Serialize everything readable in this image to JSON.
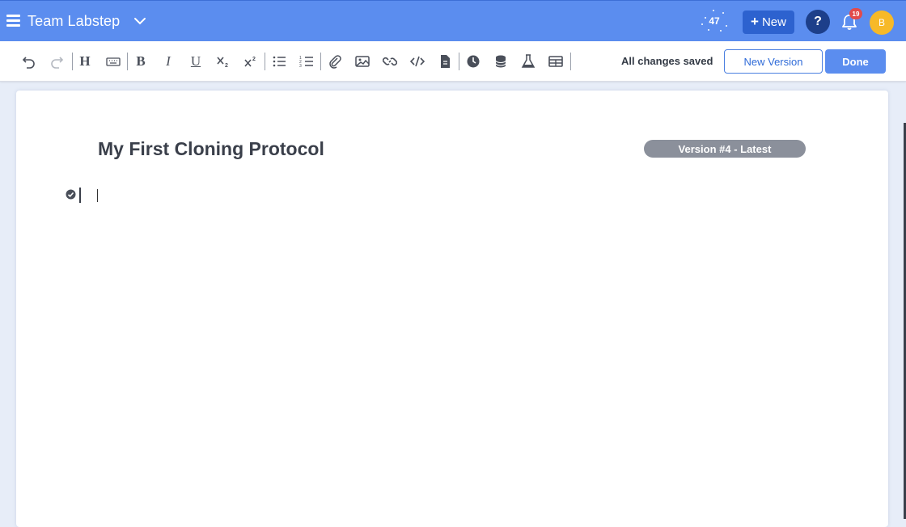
{
  "topbar": {
    "team_name": "Team Labstep",
    "points": "47",
    "new_label": "New",
    "help_label": "?",
    "notification_count": "19",
    "avatar_initial": "B",
    "colors": {
      "bar": "#5b8def",
      "new_button": "#2d62cf",
      "help": "#1d3f8a",
      "avatar": "#f7b928",
      "badge": "#e24b4b"
    }
  },
  "toolbar": {
    "tools": [
      "undo-icon",
      "redo-icon",
      "heading-icon",
      "keyboard-icon",
      "bold-icon",
      "italic-icon",
      "underline-icon",
      "subscript-icon",
      "superscript-icon",
      "bullet-list-icon",
      "numbered-list-icon",
      "attachment-icon",
      "image-icon",
      "link-icon",
      "code-icon",
      "file-icon",
      "clock-icon",
      "database-icon",
      "flask-icon",
      "table-icon"
    ],
    "heading_glyph": "H",
    "bold_glyph": "B",
    "italic_glyph": "I",
    "underline_glyph": "U",
    "status": "All changes saved",
    "new_version_label": "New Version",
    "done_label": "Done"
  },
  "document": {
    "title": "My First Cloning Protocol",
    "version_badge": "Version #4 - Latest"
  }
}
